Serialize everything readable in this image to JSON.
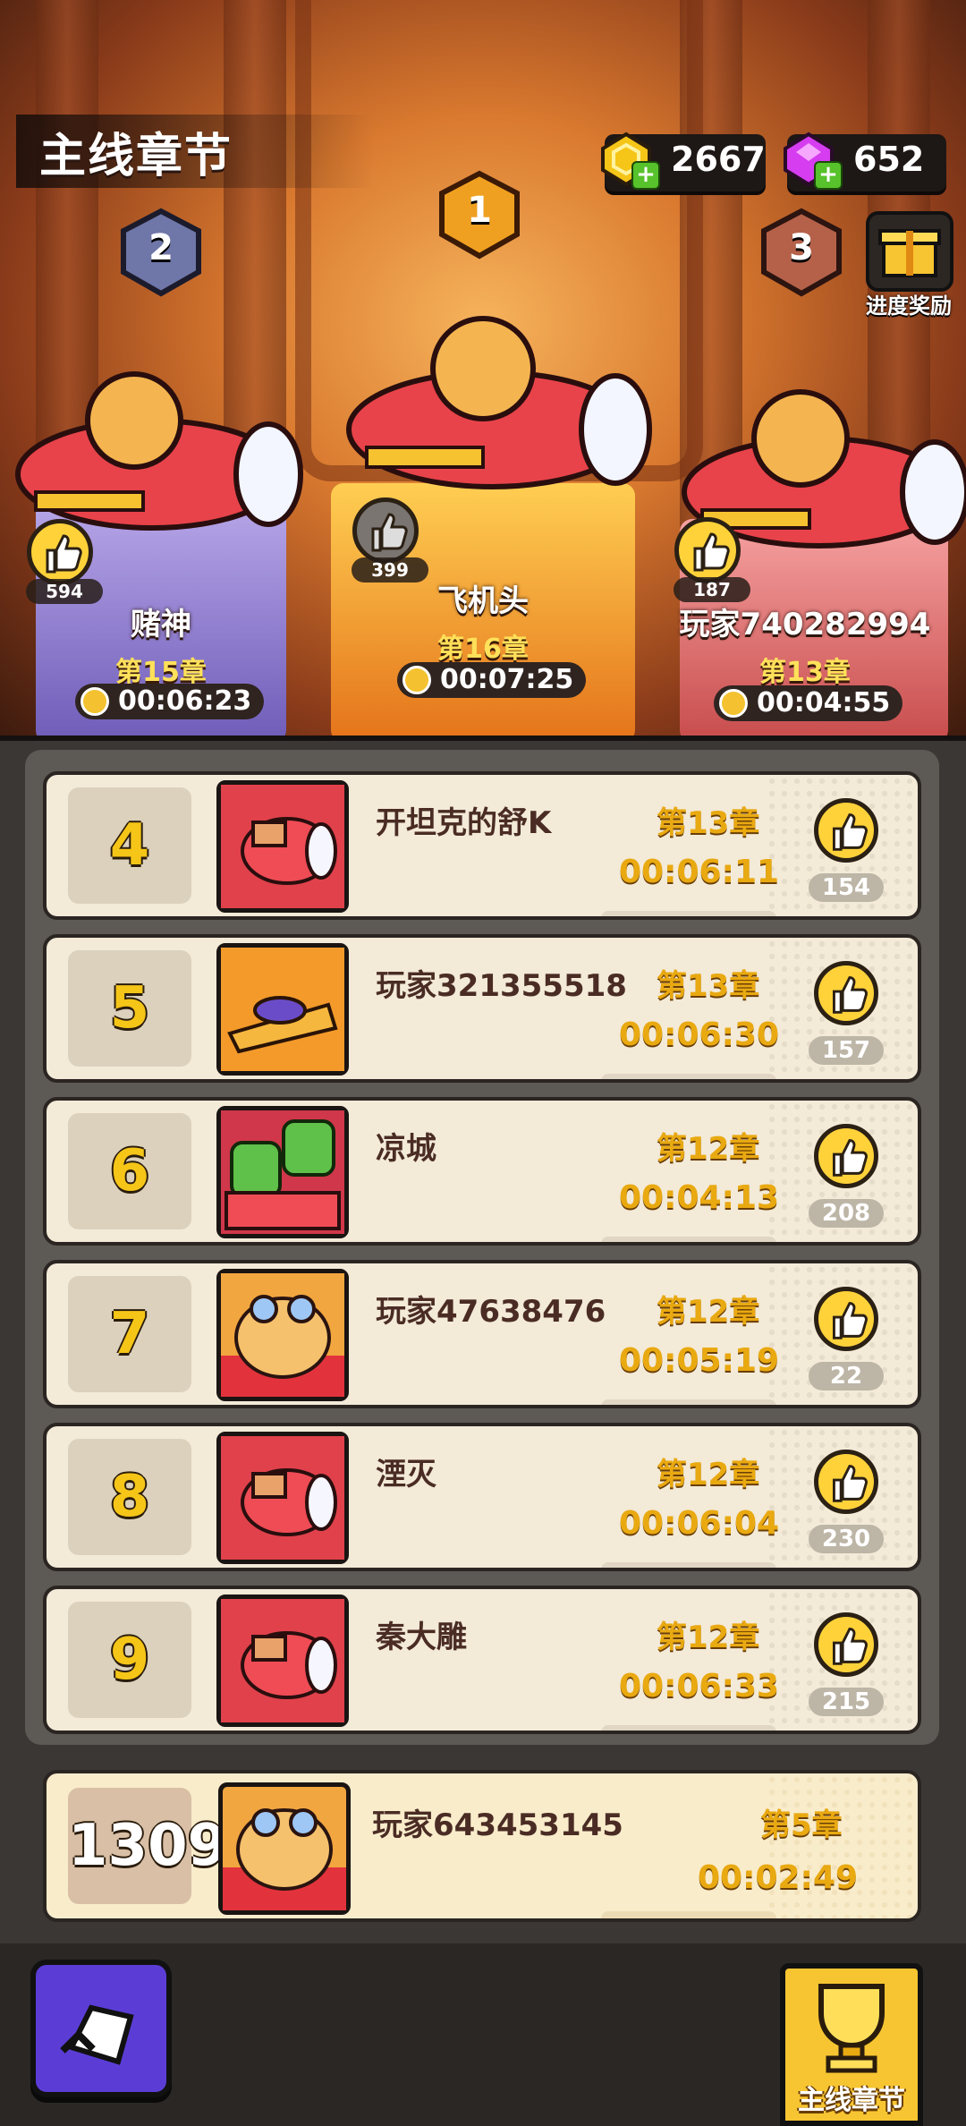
{
  "header": {
    "title": "主线章节"
  },
  "currency": [
    {
      "name": "gold",
      "value": "2667",
      "color": "#f5c518",
      "icon": "gold-coin-icon"
    },
    {
      "name": "gem",
      "value": "652",
      "color": "#d63cf0",
      "icon": "gem-icon"
    }
  ],
  "progress_reward": {
    "label": "进度奖励",
    "icon": "gift-box-icon"
  },
  "podium": [
    {
      "rank": "2",
      "name": "赌神",
      "chapter": "第15章",
      "time": "00:06:23",
      "likes": "594"
    },
    {
      "rank": "1",
      "name": "飞机头",
      "chapter": "第16章",
      "time": "00:07:25",
      "likes": "399"
    },
    {
      "rank": "3",
      "name": "玩家740282994",
      "chapter": "第13章",
      "time": "00:04:55",
      "likes": "187"
    }
  ],
  "leaderboard": [
    {
      "rank": "4",
      "name": "开坦克的舒K",
      "chapter": "第13章",
      "time": "00:06:11",
      "likes": "154",
      "avatar": "red-plane"
    },
    {
      "rank": "5",
      "name": "玩家321355518",
      "chapter": "第13章",
      "time": "00:06:30",
      "likes": "157",
      "avatar": "orange-jet"
    },
    {
      "rank": "6",
      "name": "凉城",
      "chapter": "第12章",
      "time": "00:04:13",
      "likes": "208",
      "avatar": "green-robots"
    },
    {
      "rank": "7",
      "name": "玩家47638476",
      "chapter": "第12章",
      "time": "00:05:19",
      "likes": "22",
      "avatar": "cat"
    },
    {
      "rank": "8",
      "name": "湮灭",
      "chapter": "第12章",
      "time": "00:06:04",
      "likes": "230",
      "avatar": "red-plane"
    },
    {
      "rank": "9",
      "name": "秦大雕",
      "chapter": "第12章",
      "time": "00:06:33",
      "likes": "215",
      "avatar": "red-plane"
    }
  ],
  "me": {
    "rank": "1309",
    "name": "玩家643453145",
    "chapter": "第5章",
    "time": "00:02:49",
    "avatar": "cat"
  },
  "bottom": {
    "tab_label": "主线章节",
    "back_icon": "back-arrow-icon",
    "tab_icon": "trophy-icon"
  }
}
